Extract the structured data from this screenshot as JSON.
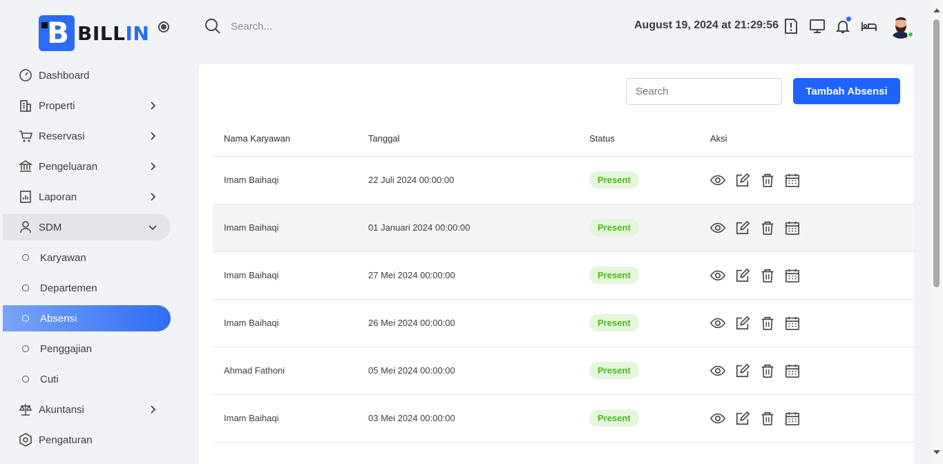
{
  "brand": {
    "logo_text": "BILL",
    "logo_text_accent": "IN",
    "logo_letter": "B"
  },
  "topbar": {
    "search_placeholder": "Search...",
    "datetime": "August 19, 2024 at 21:29:56"
  },
  "sidebar": {
    "items": [
      {
        "label": "Dashboard",
        "icon": "gauge-icon"
      },
      {
        "label": "Properti",
        "icon": "building-icon"
      },
      {
        "label": "Reservasi",
        "icon": "cart-icon"
      },
      {
        "label": "Pengeluaran",
        "icon": "bank-icon"
      },
      {
        "label": "Laporan",
        "icon": "report-icon"
      },
      {
        "label": "SDM",
        "icon": "user-icon"
      },
      {
        "label": "Karyawan"
      },
      {
        "label": "Departemen"
      },
      {
        "label": "Absensi"
      },
      {
        "label": "Penggajian"
      },
      {
        "label": "Cuti"
      },
      {
        "label": "Akuntansi",
        "icon": "scale-icon"
      },
      {
        "label": "Pengaturan",
        "icon": "settings-icon"
      }
    ]
  },
  "main": {
    "search_placeholder": "Search",
    "add_button": "Tambah Absensi",
    "columns": [
      "Nama Karyawan",
      "Tanggal",
      "Status",
      "Aksi"
    ],
    "rows": [
      {
        "name": "Imam Baihaqi",
        "date": "22 Juli 2024 00:00:00",
        "status": "Present"
      },
      {
        "name": "Imam Baihaqi",
        "date": "01 Januari 2024 00:00:00",
        "status": "Present"
      },
      {
        "name": "Imam Baihaqi",
        "date": "27 Mei 2024 00:00:00",
        "status": "Present"
      },
      {
        "name": "Imam Baihaqi",
        "date": "26 Mei 2024 00:00:00",
        "status": "Present"
      },
      {
        "name": "Ahmad Fathoni",
        "date": "05 Mei 2024 00:00:00",
        "status": "Present"
      },
      {
        "name": "Imam Baihaqi",
        "date": "03 Mei 2024 00:00:00",
        "status": "Present"
      }
    ]
  },
  "colors": {
    "accent": "#1f63ff",
    "present_bg": "#e3f7dc",
    "present_text": "#4fb81e"
  }
}
